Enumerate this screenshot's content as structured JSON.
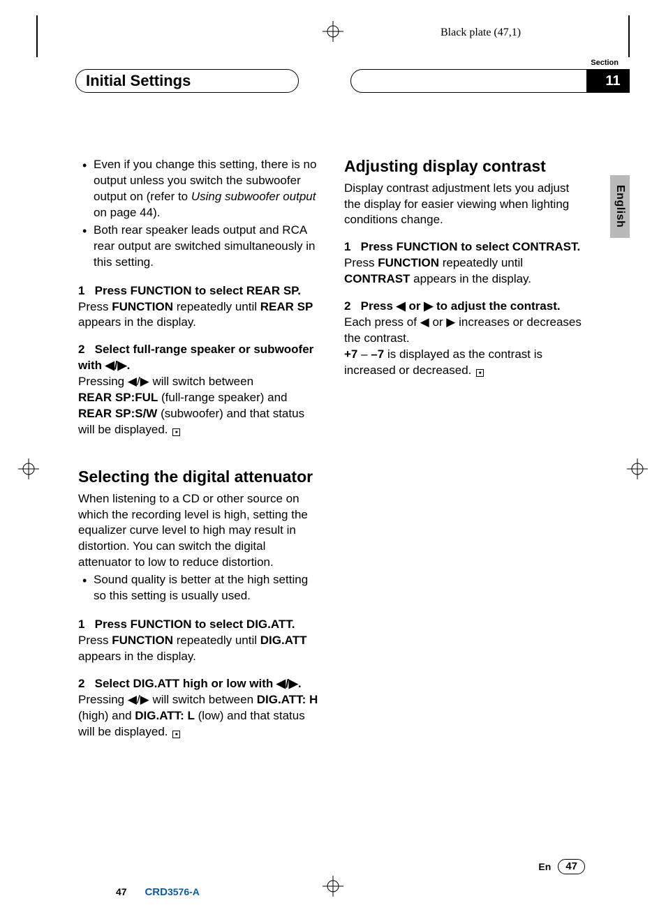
{
  "plate_label": "Black plate (47,1)",
  "header": {
    "title": "Initial Settings",
    "section_label": "Section",
    "section_number": "11"
  },
  "lang_tab": "English",
  "left": {
    "bullets": [
      {
        "pre": "Even if you change this setting, there is no output unless you switch the subwoofer output on (refer to ",
        "italic": "Using subwoofer output",
        "post": " on page 44)."
      },
      {
        "pre": "Both rear speaker leads output and RCA rear output are switched simultaneously in this setting.",
        "italic": "",
        "post": ""
      }
    ],
    "step1": {
      "num": "1",
      "head": "Press FUNCTION to select REAR SP.",
      "body_pre": "Press ",
      "b1": "FUNCTION",
      "body_mid": " repeatedly until ",
      "b2": "REAR SP",
      "body_post": " appears in the display."
    },
    "step2": {
      "num": "2",
      "head_pre": "Select full-range speaker or subwoofer with ",
      "head_icons": "◀/▶.",
      "line1_pre": "Pressing ",
      "line1_icons": "◀/▶",
      "line1_post": " will switch between",
      "b1": "REAR SP:FUL",
      "p1": " (full-range speaker) and",
      "b2": "REAR SP:S/W",
      "p2": " (subwoofer) and that status will be displayed."
    },
    "h2": "Selecting the digital attenuator",
    "intro": "When listening to a CD or other source on which the recording level is high, setting the equalizer curve level to high may result in distortion. You can switch the digital attenuator to low to reduce distortion.",
    "bullet_sq": "Sound quality is better at the high setting so this setting is usually used.",
    "step3": {
      "num": "1",
      "head": "Press FUNCTION to select DIG.ATT.",
      "body_pre": "Press ",
      "b1": "FUNCTION",
      "body_mid": " repeatedly until ",
      "b2": "DIG.ATT",
      "body_post": " appears in the display."
    },
    "step4": {
      "num": "2",
      "head_pre": "Select DIG.ATT high or low with ",
      "head_icons": "◀/▶.",
      "line_pre": "Pressing ",
      "line_icons": "◀/▶",
      "line_mid": " will switch between ",
      "b1": "DIG.ATT: H",
      "p1": " (high) and ",
      "b2": "DIG.ATT: L",
      "p2": " (low) and that status will be displayed."
    }
  },
  "right": {
    "h2": "Adjusting display contrast",
    "intro": "Display contrast adjustment lets you adjust the display for easier viewing when lighting conditions change.",
    "step1": {
      "num": "1",
      "head": "Press FUNCTION to select CONTRAST.",
      "body_pre": "Press ",
      "b1": "FUNCTION",
      "body_mid": " repeatedly until ",
      "b2": "CONTRAST",
      "body_post": " appears in the display."
    },
    "step2": {
      "num": "2",
      "head_pre": "Press ",
      "head_icons": "◀ or ▶",
      "head_post": " to adjust the contrast.",
      "line_pre": "Each press of ",
      "line_icons": "◀ or ▶",
      "line_post": " increases or decreases the contrast.",
      "b1": "+7",
      "dash": " – ",
      "b2": "–7",
      "rest": " is displayed as the contrast is increased or decreased."
    }
  },
  "footer": {
    "lang_short": "En",
    "page": "47",
    "bottom_page": "47",
    "doc_id_bold": "CRD",
    "doc_id_rest": "3576-A"
  }
}
